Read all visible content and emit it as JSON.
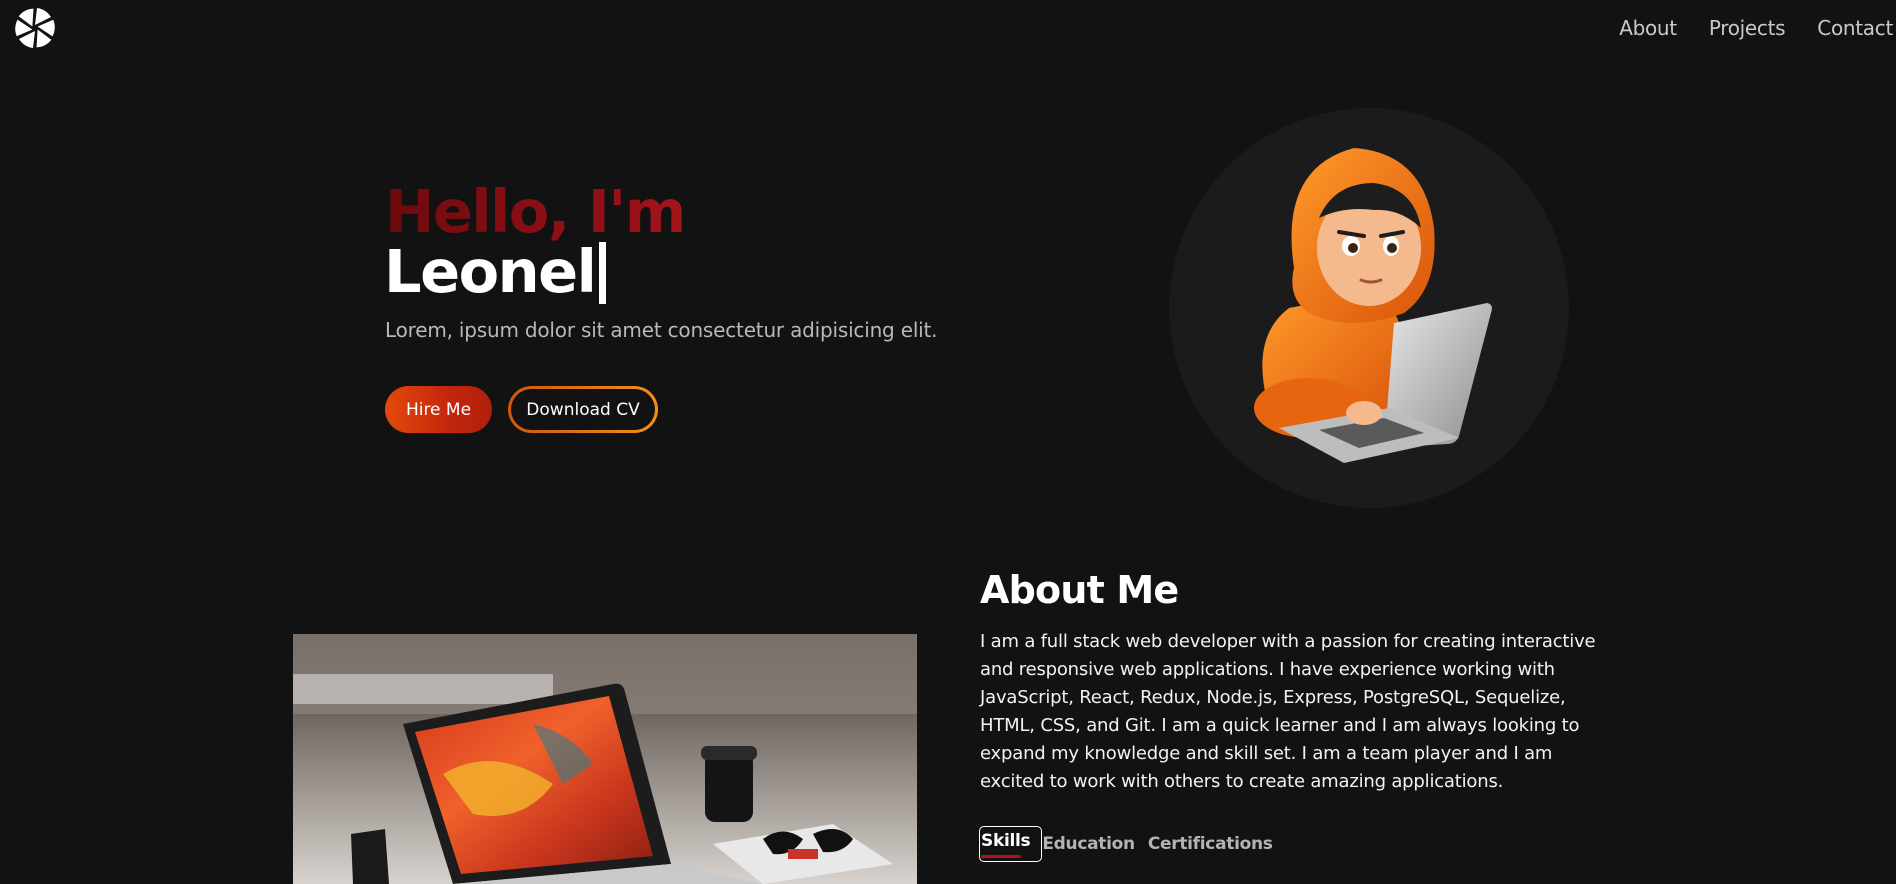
{
  "nav": {
    "about": "About",
    "projects": "Projects",
    "contact": "Contact"
  },
  "hero": {
    "greeting": "Hello, I'm",
    "name": "Leonel",
    "subtitle": "Lorem, ipsum dolor sit amet consectetur adipisicing elit.",
    "hire_label": "Hire Me",
    "cv_label": "Download CV"
  },
  "about": {
    "title": "About Me",
    "text": "I am a full stack web developer with a passion for creating interactive and responsive web applications. I have experience working with JavaScript, React, Redux, Node.js, Express, PostgreSQL, Sequelize, HTML, CSS, and Git. I am a quick learner and I am always looking to expand my knowledge and skill set. I am a team player and I am excited to work with others to create amazing applications.",
    "tabs": [
      "Skills",
      "Education",
      "Certifications"
    ],
    "active_tab": "Skills"
  },
  "colors": {
    "background": "#121212",
    "accent_red": "#a2141a",
    "accent_orange": "#e24a0a",
    "cv_border": "#f2901a"
  },
  "icons": {
    "logo": "pinwheel-logo-icon"
  }
}
